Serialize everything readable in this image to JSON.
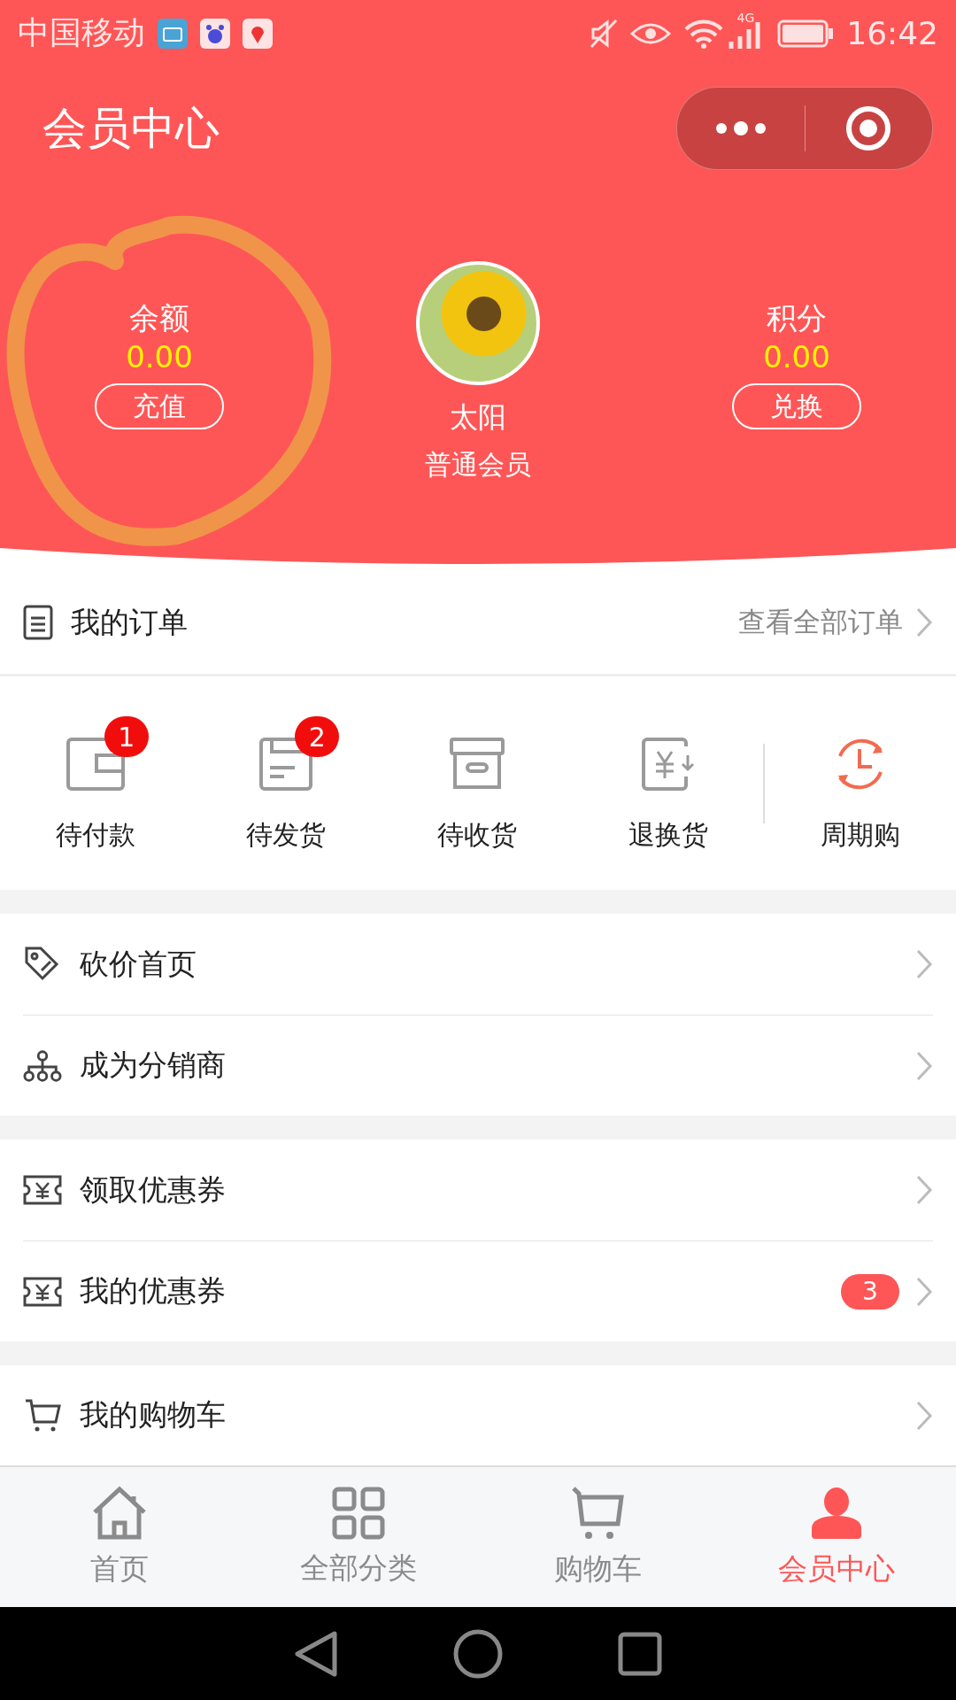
{
  "status_bar": {
    "carrier": "中国移动",
    "network": "4G",
    "time": "16:42"
  },
  "header": {
    "title": "会员中心"
  },
  "profile": {
    "balance": {
      "label": "余额",
      "value": "0.00",
      "button": "充值"
    },
    "user": {
      "name": "太阳",
      "level": "普通会员"
    },
    "points": {
      "label": "积分",
      "value": "0.00",
      "button": "兑换"
    }
  },
  "orders": {
    "title": "我的订单",
    "link": "查看全部订单"
  },
  "order_statuses": [
    {
      "kind": "pay",
      "label": "待付款",
      "badge": "1"
    },
    {
      "kind": "ship",
      "label": "待发货",
      "badge": "2"
    },
    {
      "kind": "receive",
      "label": "待收货"
    },
    {
      "kind": "return",
      "label": "退换货"
    },
    {
      "kind": "cycle",
      "label": "周期购"
    }
  ],
  "menu_groups": [
    [
      {
        "kind": "bargain",
        "label": "砍价首页"
      },
      {
        "kind": "distributor",
        "label": "成为分销商"
      }
    ],
    [
      {
        "kind": "coupon",
        "label": "领取优惠券"
      },
      {
        "kind": "coupon",
        "label": "我的优惠券",
        "badge": "3"
      }
    ],
    [
      {
        "kind": "cart",
        "label": "我的购物车"
      }
    ]
  ],
  "tabs": [
    {
      "kind": "home",
      "label": "首页",
      "selected": false
    },
    {
      "kind": "category",
      "label": "全部分类",
      "selected": false
    },
    {
      "kind": "cart",
      "label": "购物车",
      "selected": false
    },
    {
      "kind": "member",
      "label": "会员中心",
      "selected": true
    }
  ]
}
